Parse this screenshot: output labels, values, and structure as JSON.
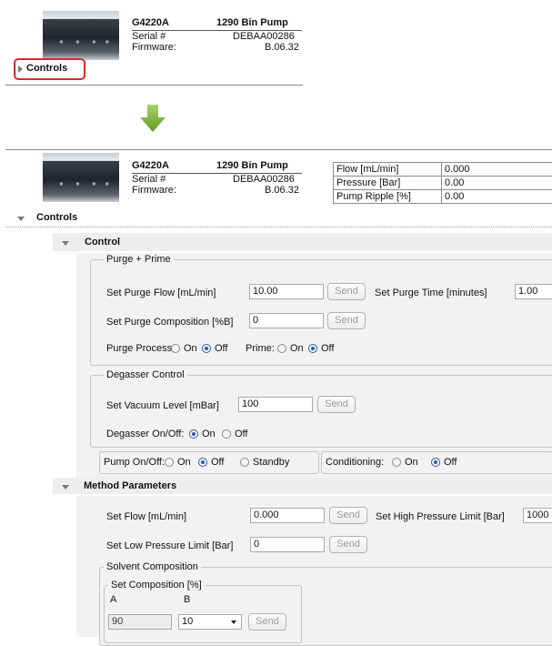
{
  "top_card": {
    "model": "G4220A",
    "name": "1290 Bin Pump",
    "serial_label": "Serial #",
    "serial_value": "DEBAA00286",
    "firmware_label": "Firmware:",
    "firmware_value": "B.06.32",
    "controls_label": "Controls"
  },
  "bottom_card": {
    "model": "G4220A",
    "name": "1290 Bin Pump",
    "serial_label": "Serial #",
    "serial_value": "DEBAA00286",
    "firmware_label": "Firmware:",
    "firmware_value": "B.06.32",
    "controls_label": "Controls",
    "status": [
      {
        "label": "Flow [mL/min]",
        "value": "0.000"
      },
      {
        "label": "Pressure [Bar]",
        "value": "0.00"
      },
      {
        "label": "Pump Ripple [%]",
        "value": "0.00"
      }
    ]
  },
  "control": {
    "title": "Control",
    "purge": {
      "legend": "Purge + Prime",
      "flow_label": "Set Purge Flow [mL/min]",
      "flow_value": "10.00",
      "send": "Send",
      "time_label": "Set Purge Time [minutes]",
      "time_value": "1.00",
      "comp_label": "Set Purge Composition [%B]",
      "comp_value": "0",
      "process_label": "Purge Process:",
      "prime_label": "Prime:",
      "on": "On",
      "off": "Off"
    },
    "degasser": {
      "legend": "Degasser Control",
      "vacuum_label": "Set Vacuum Level [mBar]",
      "vacuum_value": "100",
      "send": "Send",
      "onoff_label": "Degasser On/Off:",
      "on": "On",
      "off": "Off"
    },
    "pump_onoff": {
      "label": "Pump On/Off:",
      "on": "On",
      "off": "Off",
      "standby": "Standby"
    },
    "conditioning": {
      "label": "Conditioning:",
      "on": "On",
      "off": "Off"
    }
  },
  "method": {
    "title": "Method Parameters",
    "flow_label": "Set Flow [mL/min]",
    "flow_value": "0.000",
    "send": "Send",
    "high_label": "Set High Pressure Limit [Bar]",
    "high_value": "1000",
    "low_label": "Set Low Pressure Limit [Bar]",
    "low_value": "0",
    "solvent_legend": "Solvent Composition",
    "comp_legend": "Set Composition [%]",
    "col_a": "A",
    "col_b": "B",
    "a_value": "90",
    "b_value": "10"
  },
  "colors": {
    "highlight": "#e0282e",
    "arrow": "#7fb23c",
    "accent_radio": "#2c5ea8"
  }
}
